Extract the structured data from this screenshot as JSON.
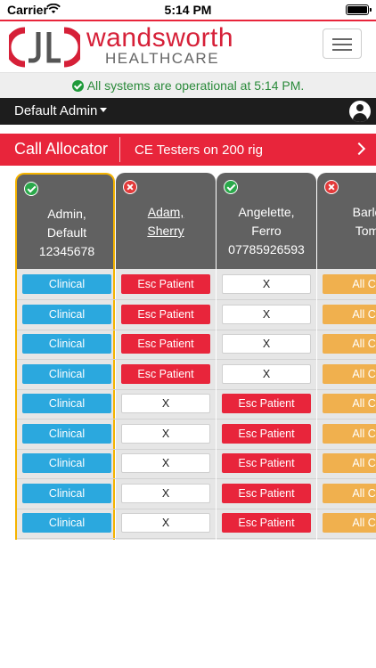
{
  "status_bar": {
    "carrier": "Carrier",
    "time": "5:14 PM"
  },
  "brand": {
    "name": "wandsworth",
    "subtitle": "HEALTHCARE",
    "color": "#d62038"
  },
  "system_status": {
    "message": "All systems are operational at 5:14 PM.",
    "color": "#2a8a3a"
  },
  "user": {
    "name": "Default Admin"
  },
  "allocator": {
    "title": "Call Allocator",
    "group": "CE Testers on 200 rig"
  },
  "colors": {
    "clinical": "#2ba8de",
    "esc": "#e8253b",
    "allca": "#f0b04e",
    "header_red": "#e8253b"
  },
  "columns": [
    {
      "status": "ok",
      "name_lines": [
        "Admin,",
        "Default",
        "12345678"
      ],
      "link": false,
      "selected": true,
      "cells": [
        "Clinical",
        "Clinical",
        "Clinical",
        "Clinical",
        "Clinical",
        "Clinical",
        "Clinical",
        "Clinical",
        "Clinical"
      ]
    },
    {
      "status": "bad",
      "name_lines": [
        "Adam,",
        "Sherry"
      ],
      "link": true,
      "selected": false,
      "cells": [
        "Esc Patient",
        "Esc Patient",
        "Esc Patient",
        "Esc Patient",
        "X",
        "X",
        "X",
        "X",
        "X"
      ]
    },
    {
      "status": "ok",
      "name_lines": [
        "Angelette,",
        "Ferro",
        "07785926593"
      ],
      "link": false,
      "selected": false,
      "cells": [
        "X",
        "X",
        "X",
        "X",
        "Esc Patient",
        "Esc Patient",
        "Esc Patient",
        "Esc Patient",
        "Esc Patient"
      ]
    },
    {
      "status": "bad",
      "name_lines": [
        "Barlo",
        "Tom"
      ],
      "link": false,
      "selected": false,
      "cells": [
        "All Ca",
        "All Ca",
        "All Ca",
        "All Ca",
        "All Ca",
        "All Ca",
        "All Ca",
        "All Ca",
        "All Ca"
      ]
    }
  ]
}
